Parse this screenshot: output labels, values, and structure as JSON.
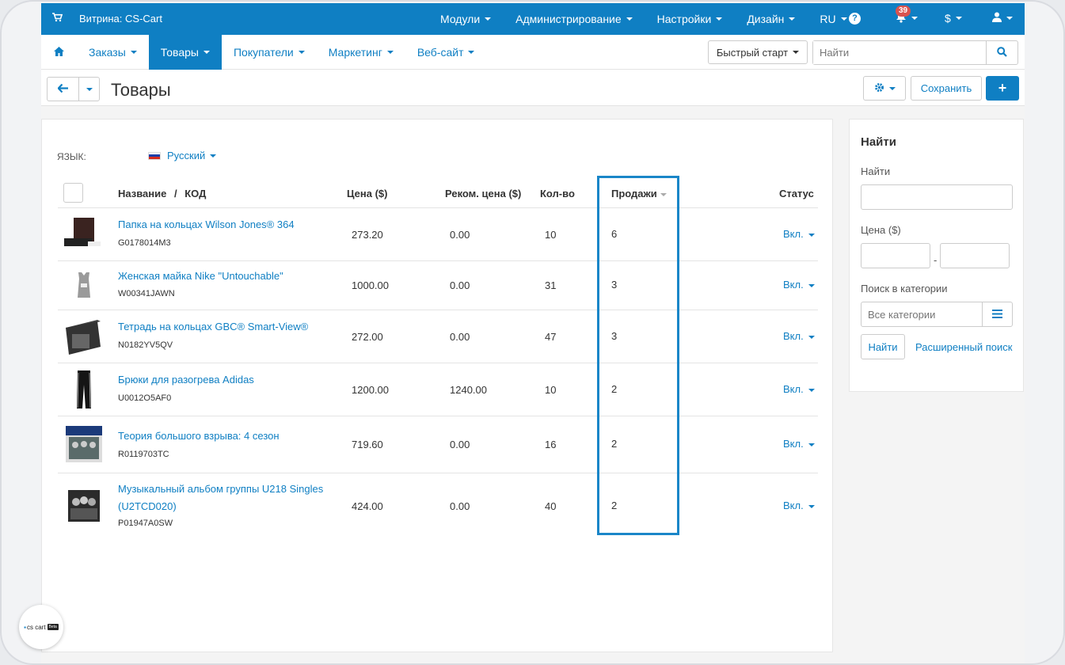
{
  "topbar": {
    "storefront_label": "Витрина: CS-Cart",
    "menu": [
      "Модули",
      "Администрирование",
      "Настройки",
      "Дизайн",
      "RU"
    ],
    "notifications_count": "39",
    "currency": "$"
  },
  "subnav": {
    "items": [
      "Заказы",
      "Товары",
      "Покупатели",
      "Маркетинг",
      "Веб-сайт"
    ],
    "active": "Товары",
    "quickstart_label": "Быстрый старт",
    "search_placeholder": "Найти"
  },
  "titlebar": {
    "title": "Товары",
    "save_label": "Сохранить"
  },
  "main": {
    "lang_label": "ЯЗЫК:",
    "lang_value": "Русский",
    "columns": {
      "name": "Название",
      "separator": "/",
      "code": "КОД",
      "price": "Цена ($)",
      "list_price": "Реком. цена ($)",
      "qty": "Кол-во",
      "sales": "Продажи",
      "status": "Статус"
    },
    "rows": [
      {
        "name": "Папка на кольцах Wilson Jones® 364",
        "code": "G0178014M3",
        "price": "273.20",
        "list_price": "0.00",
        "qty": "10",
        "sales": "6",
        "status": "Вкл."
      },
      {
        "name": "Женская майка Nike \"Untouchable\"",
        "code": "W00341JAWN",
        "price": "1000.00",
        "list_price": "0.00",
        "qty": "31",
        "sales": "3",
        "status": "Вкл."
      },
      {
        "name": "Тетрадь на кольцах GBC® Smart-View®",
        "code": "N0182YV5QV",
        "price": "272.00",
        "list_price": "0.00",
        "qty": "47",
        "sales": "3",
        "status": "Вкл."
      },
      {
        "name": "Брюки для разогрева Adidas",
        "code": "U0012O5AF0",
        "price": "1200.00",
        "list_price": "1240.00",
        "qty": "10",
        "sales": "2",
        "status": "Вкл."
      },
      {
        "name": "Теория большого взрыва: 4 сезон",
        "code": "R0119703TC",
        "price": "719.60",
        "list_price": "0.00",
        "qty": "16",
        "sales": "2",
        "status": "Вкл."
      },
      {
        "name": "Музыкальный альбом группы U218 Singles (U2TCD020)",
        "code": "P01947A0SW",
        "price": "424.00",
        "list_price": "0.00",
        "qty": "40",
        "sales": "2",
        "status": "Вкл."
      }
    ]
  },
  "sidebar": {
    "title": "Найти",
    "find_label": "Найти",
    "price_label": "Цена ($)",
    "price_dash": "-",
    "category_label": "Поиск в категории",
    "category_placeholder": "Все категории",
    "find_button": "Найти",
    "advanced_link": "Расширенный поиск"
  },
  "logo": {
    "text": "cs cart",
    "tag": "Beta"
  },
  "colors": {
    "accent": "#0f7fc3",
    "highlight": "#1a86c8",
    "badge": "#d9534f"
  }
}
